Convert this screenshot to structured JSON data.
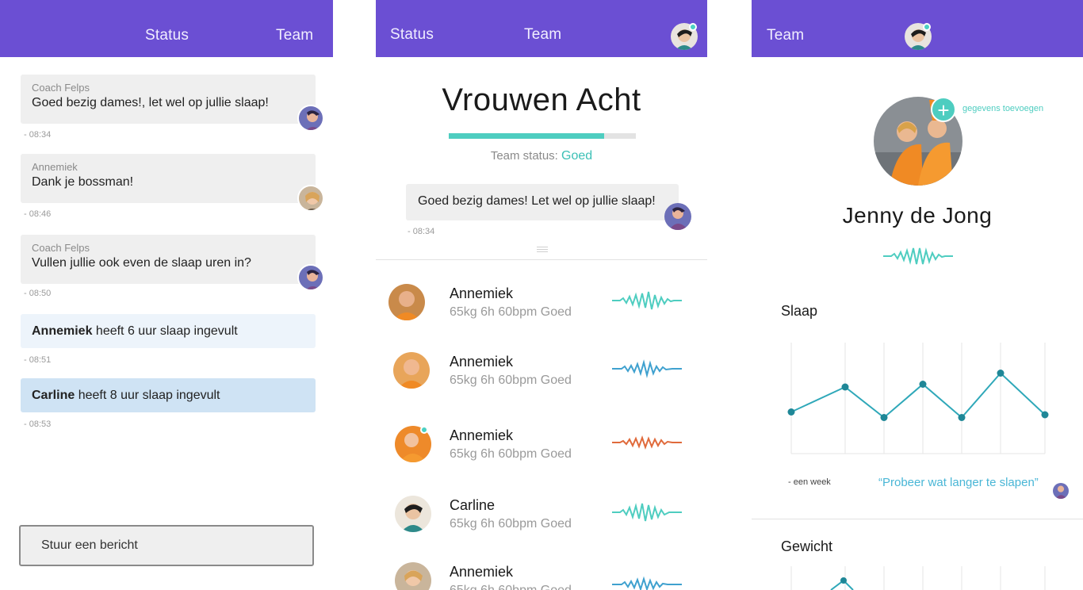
{
  "colors": {
    "header": "#6b4fd3",
    "accent": "#4ecdc0",
    "link": "#49b6d6",
    "wave_alert": "#e06a3b",
    "wave_blue": "#3fa1cf"
  },
  "chat_screen": {
    "tabs": {
      "status": "Status",
      "team": "Team"
    },
    "messages": [
      {
        "sender": "Coach Felps",
        "text": "Goed bezig dames!, let wel op jullie slaap!",
        "time": "- 08:34"
      },
      {
        "sender": "Annemiek",
        "text": "Dank je bossman!",
        "time": "- 08:46"
      },
      {
        "sender": "Coach Felps",
        "text": "Vullen jullie ook even de slaap uren in?",
        "time": "- 08:50"
      }
    ],
    "events": [
      {
        "name": "Annemiek",
        "text": " heeft 6 uur slaap ingevult",
        "time": "- 08:51"
      },
      {
        "name": "Carline",
        "text": " heeft 8 uur slaap ingevult",
        "time": "- 08:53"
      }
    ],
    "composer_placeholder": "Stuur een bericht"
  },
  "team_screen": {
    "tabs": {
      "status": "Status",
      "team": "Team"
    },
    "title": "Vrouwen Acht",
    "progress": 0.83,
    "status_label": "Team status:",
    "status_value": "Goed",
    "coach_message": "Goed bezig dames! Let wel op jullie slaap!",
    "coach_time": "- 08:34",
    "members": [
      {
        "name": "Annemiek",
        "stats": "65kg 6h 60bpm Goed",
        "wave": "teal"
      },
      {
        "name": "Annemiek",
        "stats": "65kg 6h 60bpm Goed",
        "wave": "blue"
      },
      {
        "name": "Annemiek",
        "stats": "65kg 6h 60bpm Goed",
        "wave": "orange"
      },
      {
        "name": "Carline",
        "stats": "65kg 6h 60bpm Goed",
        "wave": "teal"
      },
      {
        "name": "Annemiek",
        "stats": "65kg 6h 60bpm Goed",
        "wave": "blue"
      }
    ]
  },
  "profile_screen": {
    "tabs": {
      "team": "Team"
    },
    "add_data_label": "gegevens toevoegen",
    "name": "Jenny de Jong",
    "sleep": {
      "title": "Slaap",
      "period": "- een week",
      "quote": "“Probeer wat langer te slapen”",
      "points": [
        4.5,
        5.4,
        4.3,
        5.5,
        4.3,
        5.9,
        4.4
      ]
    },
    "weight": {
      "title": "Gewicht"
    }
  }
}
